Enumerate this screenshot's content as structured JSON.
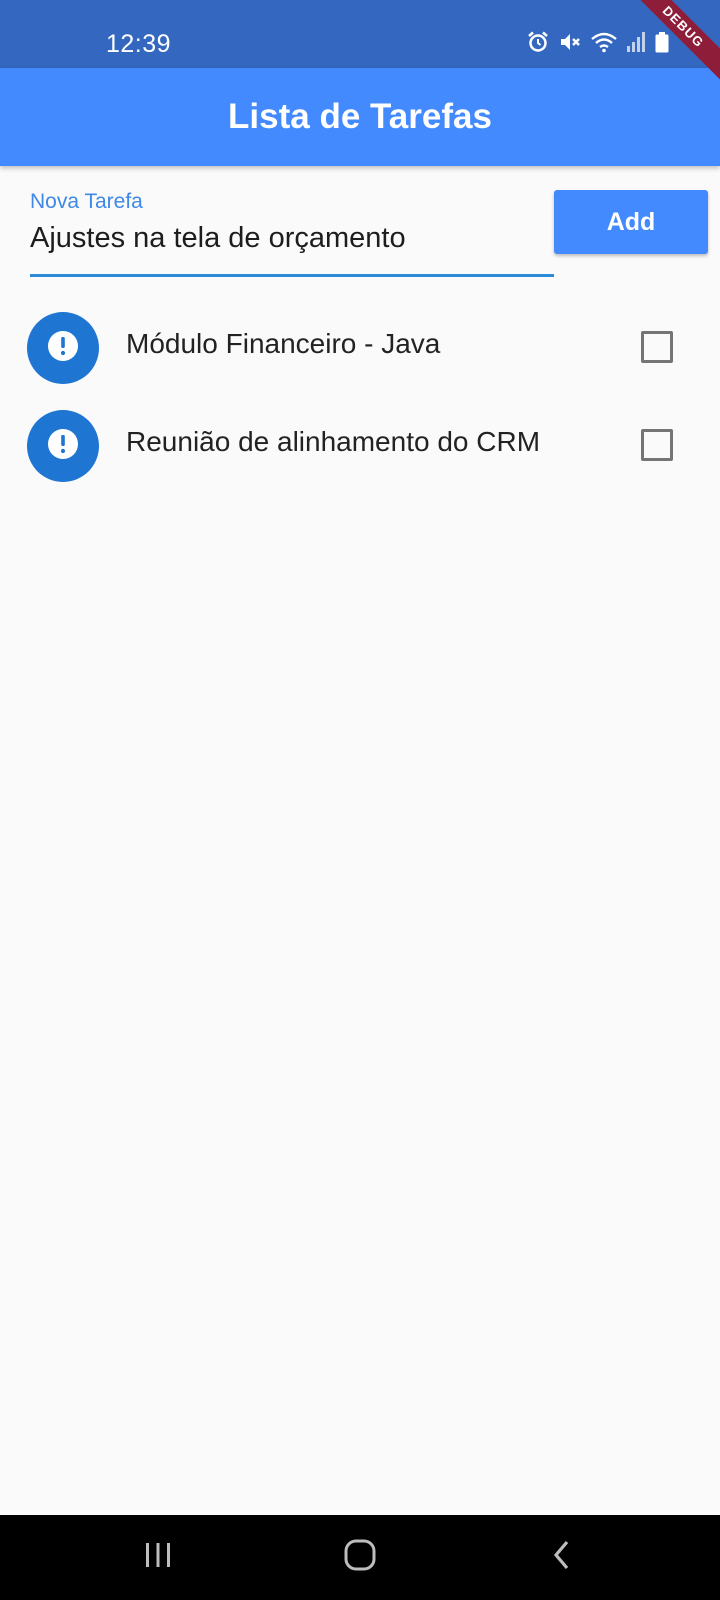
{
  "status_bar": {
    "time": "12:39",
    "icons": [
      "alarm-icon",
      "mute-icon",
      "wifi-icon",
      "signal-icon",
      "battery-icon"
    ],
    "debug_banner": "DEBUG"
  },
  "app_bar": {
    "title": "Lista de Tarefas",
    "color": "#448aff"
  },
  "new_task": {
    "label": "Nova Tarefa",
    "value": "Ajustes na tela de orçamento",
    "add_label": "Add"
  },
  "tasks": [
    {
      "label": "Módulo Financeiro - Java",
      "icon": "alert-icon",
      "checked": false
    },
    {
      "label": "Reunião de alinhamento do CRM",
      "icon": "alert-icon",
      "checked": false
    }
  ],
  "nav_bar": {
    "buttons": [
      "recent-apps-icon",
      "home-icon",
      "back-icon"
    ]
  }
}
